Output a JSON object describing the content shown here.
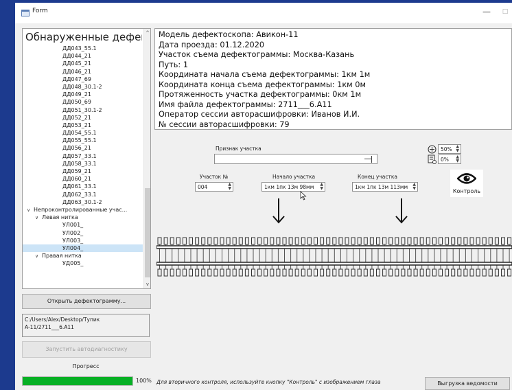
{
  "window": {
    "title": "Form",
    "minimize": "—",
    "maximize": "□"
  },
  "tree": {
    "header": "Обнаруженные дефекты",
    "items": [
      {
        "label": "ДД043_55.1",
        "indent": 2,
        "chevron": ""
      },
      {
        "label": "ДД044_21",
        "indent": 2,
        "chevron": ""
      },
      {
        "label": "ДД045_21",
        "indent": 2,
        "chevron": ""
      },
      {
        "label": "ДД046_21",
        "indent": 2,
        "chevron": ""
      },
      {
        "label": "ДД047_69",
        "indent": 2,
        "chevron": ""
      },
      {
        "label": "ДД048_30.1-2",
        "indent": 2,
        "chevron": ""
      },
      {
        "label": "ДД049_21",
        "indent": 2,
        "chevron": ""
      },
      {
        "label": "ДД050_69",
        "indent": 2,
        "chevron": ""
      },
      {
        "label": "ДД051_30.1-2",
        "indent": 2,
        "chevron": ""
      },
      {
        "label": "ДД052_21",
        "indent": 2,
        "chevron": ""
      },
      {
        "label": "ДД053_21",
        "indent": 2,
        "chevron": ""
      },
      {
        "label": "ДД054_55.1",
        "indent": 2,
        "chevron": ""
      },
      {
        "label": "ДД055_55.1",
        "indent": 2,
        "chevron": ""
      },
      {
        "label": "ДД056_21",
        "indent": 2,
        "chevron": ""
      },
      {
        "label": "ДД057_33.1",
        "indent": 2,
        "chevron": ""
      },
      {
        "label": "ДД058_33.1",
        "indent": 2,
        "chevron": ""
      },
      {
        "label": "ДД059_21",
        "indent": 2,
        "chevron": ""
      },
      {
        "label": "ДД060_21",
        "indent": 2,
        "chevron": ""
      },
      {
        "label": "ДД061_33.1",
        "indent": 2,
        "chevron": ""
      },
      {
        "label": "ДД062_33.1",
        "indent": 2,
        "chevron": ""
      },
      {
        "label": "ДД063_30.1-2",
        "indent": 2,
        "chevron": ""
      },
      {
        "label": "Непроконтролированные учас...",
        "indent": 0,
        "chevron": "∨"
      },
      {
        "label": "Левая нитка",
        "indent": 1,
        "chevron": "∨"
      },
      {
        "label": "УЛ001_",
        "indent": 2,
        "chevron": ""
      },
      {
        "label": "УЛ002_",
        "indent": 2,
        "chevron": ""
      },
      {
        "label": "УЛ003_",
        "indent": 2,
        "chevron": ""
      },
      {
        "label": "УЛ004_",
        "indent": 2,
        "chevron": "",
        "selected": true
      },
      {
        "label": "Правая нитка",
        "indent": 1,
        "chevron": "∨"
      },
      {
        "label": "УД005_",
        "indent": 2,
        "chevron": ""
      }
    ]
  },
  "buttons": {
    "open": "Открыть дефектограмму...",
    "run": "Запустить автодиагностику",
    "export": "Выгрузка ведомости"
  },
  "file_path": {
    "line1": "C:/Users/Alex/Desktop/Тупик",
    "line2": "A-11/2711___6.A11"
  },
  "progress": {
    "label": "Прогресс",
    "value": 100,
    "text": "100%"
  },
  "hint": "Для вторичного контроля, используйте кнопку \"Контроль\" с изображением глаза",
  "info": [
    "Модель дефектоскопа: Авикон-11",
    "Дата проезда: 01.12.2020",
    "Участок съема дефектограммы: Москва-Казань",
    "Путь: 1",
    "Координата начала съема дефектограммы: 1км 1м",
    "Координата конца съема дефектограммы: 1км 0м",
    "Протяженность участка дефектограммы: 0км 1м",
    "Имя файла дефектограммы: 2711___6.A11",
    "Оператор сессии авторасшифровки: Иванов И.И.",
    "№ сессии авторасшифровки: 79"
  ],
  "segment": {
    "attr_label": "Признак участка",
    "num_label": "Участок №",
    "num_value": "004",
    "start_label": "Начало участка",
    "start_value": "1км 1пк 13м 98мм",
    "end_label": "Конец участка",
    "end_value": "1км 1пк 13м 113мм"
  },
  "zoom": {
    "scale1": "50%",
    "scale2": "0%"
  },
  "control_label": "Контроль",
  "icons": {
    "zoom": "zoom-icon",
    "scale": "scale-icon",
    "eye": "eye-icon",
    "arrow": "arrow-down-icon"
  }
}
